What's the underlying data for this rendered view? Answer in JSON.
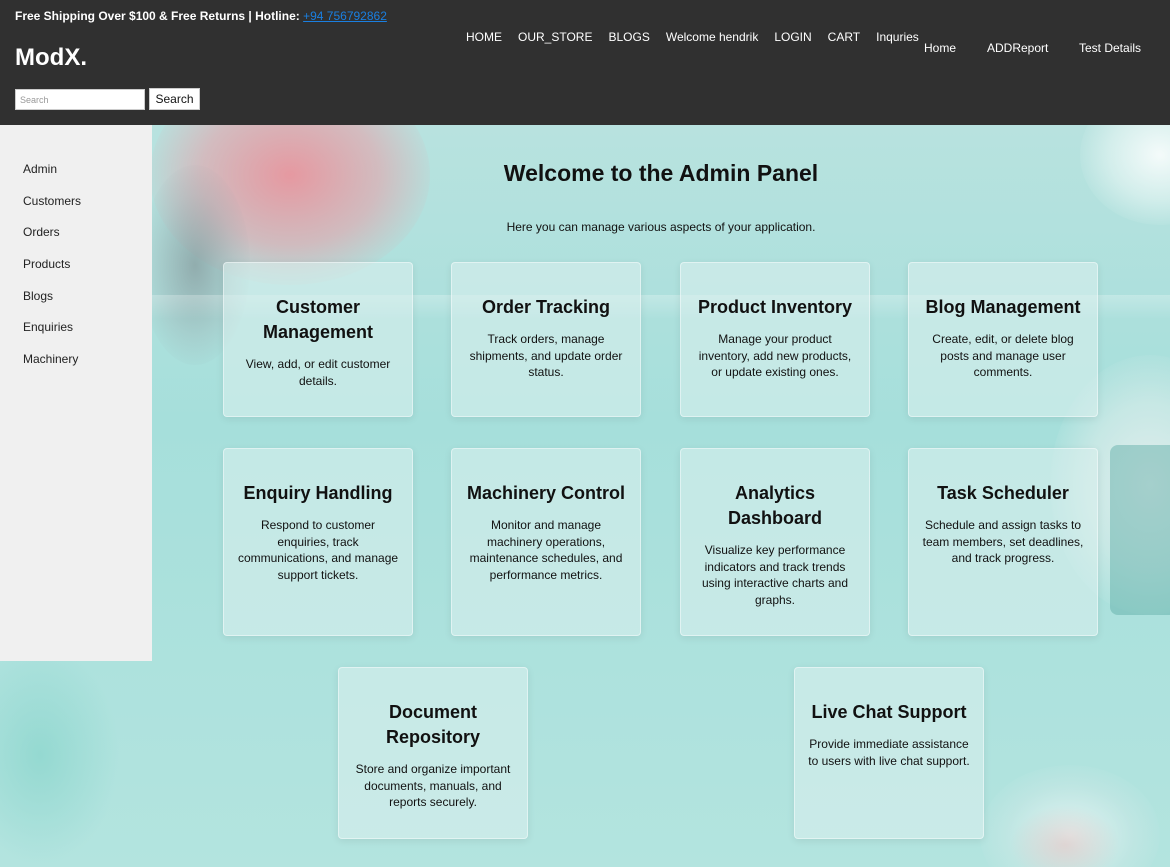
{
  "header": {
    "promo_text": "Free Shipping Over $100 & Free Returns | Hotline:",
    "hotline": "+94 756792862",
    "logo": "ModX.",
    "search_placeholder": "Search",
    "search_button": "Search",
    "nav": [
      "HOME",
      "OUR_STORE",
      "BLOGS",
      "Welcome hendrik",
      "LOGIN",
      "CART",
      "Inquries"
    ],
    "admin_nav": [
      "Home",
      "ADDReport",
      "Test Details"
    ]
  },
  "sidebar": {
    "items": [
      "Admin",
      "Customers",
      "Orders",
      "Products",
      "Blogs",
      "Enquiries",
      "Machinery"
    ]
  },
  "main": {
    "title": "Welcome to the Admin Panel",
    "subtitle": "Here you can manage various aspects of your application.",
    "cards": [
      {
        "title": "Customer Management",
        "description": "View, add, or edit customer details."
      },
      {
        "title": "Order Tracking",
        "description": "Track orders, manage shipments, and update order status."
      },
      {
        "title": "Product Inventory",
        "description": "Manage your product inventory, add new products, or update existing ones."
      },
      {
        "title": "Blog Management",
        "description": "Create, edit, or delete blog posts and manage user comments."
      },
      {
        "title": "Enquiry Handling",
        "description": "Respond to customer enquiries, track communications, and manage support tickets."
      },
      {
        "title": "Machinery Control",
        "description": "Monitor and manage machinery operations, maintenance schedules, and performance metrics."
      },
      {
        "title": "Analytics Dashboard",
        "description": "Visualize key performance indicators and track trends using interactive charts and graphs."
      },
      {
        "title": "Task Scheduler",
        "description": "Schedule and assign tasks to team members, set deadlines, and track progress."
      },
      {
        "title": "Document Repository",
        "description": "Store and organize important documents, manuals, and reports securely."
      },
      {
        "title": "Live Chat Support",
        "description": "Provide immediate assistance to users with live chat support."
      }
    ]
  },
  "colors": {
    "header_bg": "#303030",
    "sidebar_bg": "#f0f0f0",
    "link": "#1a7fe0",
    "page_bg": "#a8dedb"
  }
}
